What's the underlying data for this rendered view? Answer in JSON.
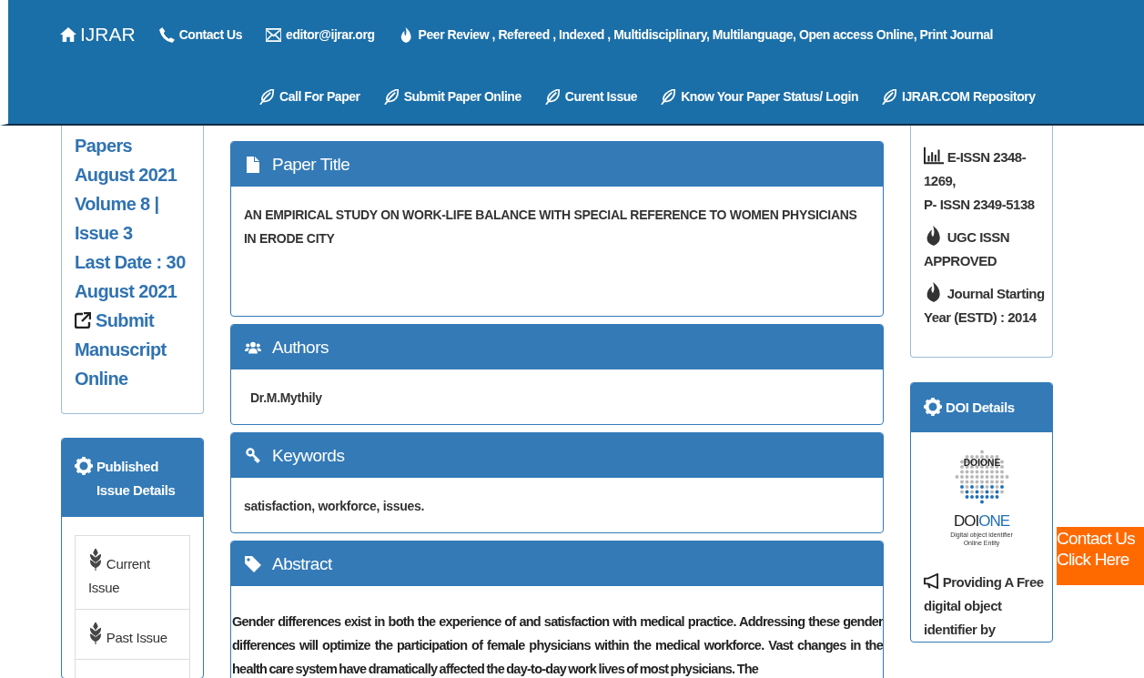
{
  "header": {
    "brand": "IJRAR",
    "top_links": [
      {
        "kind": "phone",
        "label": "Contact Us"
      },
      {
        "kind": "mail",
        "label": "editor@ijrar.org"
      },
      {
        "kind": "fire",
        "label": "Peer Review , Refereed , Indexed , Multidisciplinary, Multilanguage, Open access Online, Print Journal"
      }
    ],
    "nav": [
      "Call For Paper",
      "Submit Paper Online",
      "Curent Issue",
      "Know Your Paper Status/ Login",
      "IJRAR.COM Repository"
    ]
  },
  "left": {
    "lines": [
      "Papers",
      "August 2021",
      "Volume 8 |",
      "Issue 3",
      "Last Date : 30",
      "August 2021"
    ],
    "submit_link": "Submit Manuscript Online",
    "published": {
      "title": "Published Issue Details",
      "items": [
        "Current Issue",
        "Past Issue"
      ]
    }
  },
  "panels": [
    {
      "kind": "file",
      "title": "Paper Title",
      "body": "AN EMPIRICAL STUDY ON WORK-LIFE BALANCE WITH SPECIAL REFERENCE TO WOMEN PHYSICIANS IN ERODE CITY"
    },
    {
      "kind": "users",
      "title": "Authors",
      "body": "Dr.M.Mythily"
    },
    {
      "kind": "key",
      "title": "Keywords",
      "body": "satisfaction, workforce, issues."
    },
    {
      "kind": "tag",
      "title": "Abstract",
      "body": "Gender differences exist in both the experience of and satisfaction with medical practice. Addressing these gender differences will optimize the participation of female physicians within the medical workforce. Vast changes in the health care system have dramatically affected the day-to-day work lives of most physicians. The"
    }
  ],
  "right": {
    "issn": [
      {
        "kind": "chart",
        "text": "E-ISSN 2348-1269,"
      },
      {
        "kind": "plain",
        "text": "P- ISSN 2349-5138"
      },
      {
        "kind": "fire",
        "text": "UGC ISSN APPROVED"
      },
      {
        "kind": "fire",
        "text": "Journal Starting Year (ESTD) : 2014"
      }
    ],
    "doi": {
      "title": "DOI Details",
      "logo_small": "DOIONE",
      "logo_a": "DOI",
      "logo_b": "ONE",
      "logo_caption_1": "Digital object identifier",
      "logo_caption_2": "Online Entity",
      "text": "Providing A Free digital object identifier by"
    }
  },
  "contact_tab": [
    "Contact Us",
    "Click Here"
  ]
}
